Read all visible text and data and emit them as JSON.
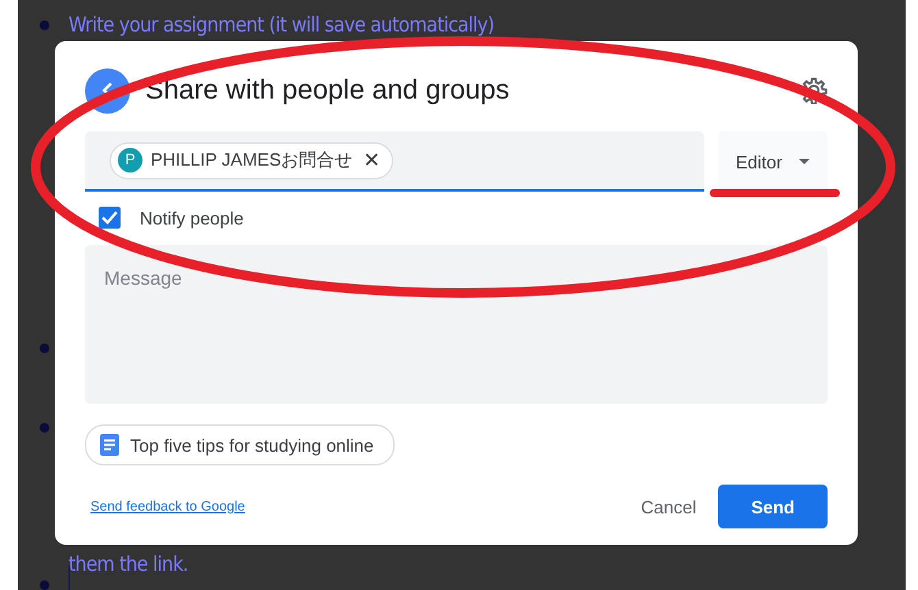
{
  "document": {
    "lines": [
      "Write your assignment (it will save automatically)",
      "them the link."
    ]
  },
  "dialog": {
    "title": "Share with people and groups",
    "recipient": {
      "initial": "P",
      "name": "PHILLIP JAMESお問合せ",
      "remove": "✕"
    },
    "role": "Editor",
    "notify": {
      "label": "Notify people",
      "checked": true
    },
    "message": {
      "placeholder": "Message"
    },
    "attachment": "Top five tips for studying online",
    "feedback_link": "Send feedback to Google",
    "buttons": [
      {
        "label": "Cancel",
        "kind": "text"
      },
      {
        "label": "Send",
        "kind": "primary"
      }
    ]
  },
  "annotations": {
    "ellipse": true,
    "underline": true
  }
}
